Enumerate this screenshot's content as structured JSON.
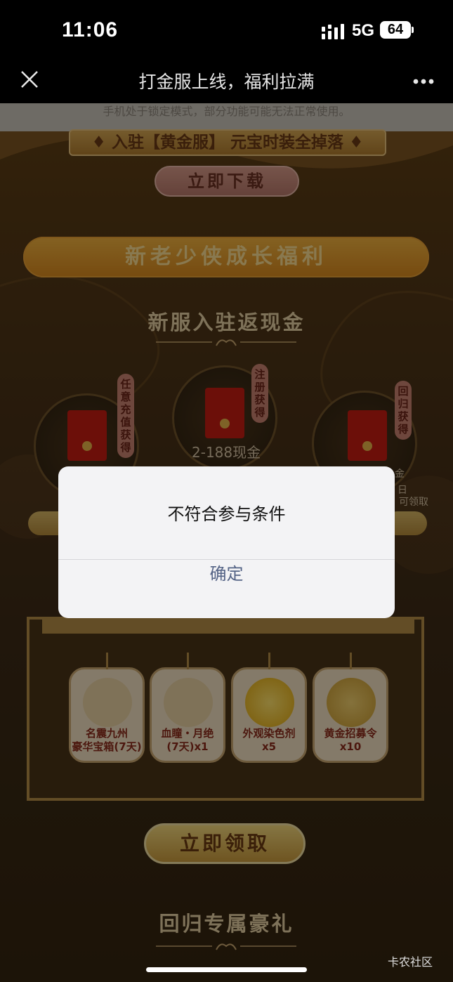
{
  "status_bar": {
    "time": "11:06",
    "network": "5G",
    "battery": "64"
  },
  "nav": {
    "title": "打金服上线，福利拉满"
  },
  "lock_notice": "手机处于锁定模式，部分功能可能无法正常使用。",
  "banner": {
    "strip_text": "♦ 入驻【黄金服】 元宝时装全掉落 ♦",
    "download_button": "立即下载"
  },
  "welfare_bar": "新老少侠成长福利",
  "section_cashback": {
    "title": "新服入驻返现金",
    "items": [
      {
        "tag": "任意充值获得"
      },
      {
        "tag": "注册获得",
        "amount": "2-188现金"
      },
      {
        "tag": "回归获得"
      }
    ],
    "right_partial": [
      "金",
      "日",
      "可领取"
    ]
  },
  "rewards": [
    {
      "label": "名震九州\n豪华宝箱(7天)"
    },
    {
      "label": "血瞳・月绝\n(7天)x1"
    },
    {
      "label": "外观染色剂\nx5"
    },
    {
      "label": "黄金招募令\nx10"
    }
  ],
  "claim_button": "立即领取",
  "section_return": {
    "title": "回归专属豪礼"
  },
  "dialog": {
    "message": "不符合参与条件",
    "confirm": "确定"
  },
  "watermark": "卡农社区",
  "colors": {
    "accent_gold": "#d8881d",
    "envelope_red": "#c51c12",
    "dialog_button": "#556486"
  }
}
